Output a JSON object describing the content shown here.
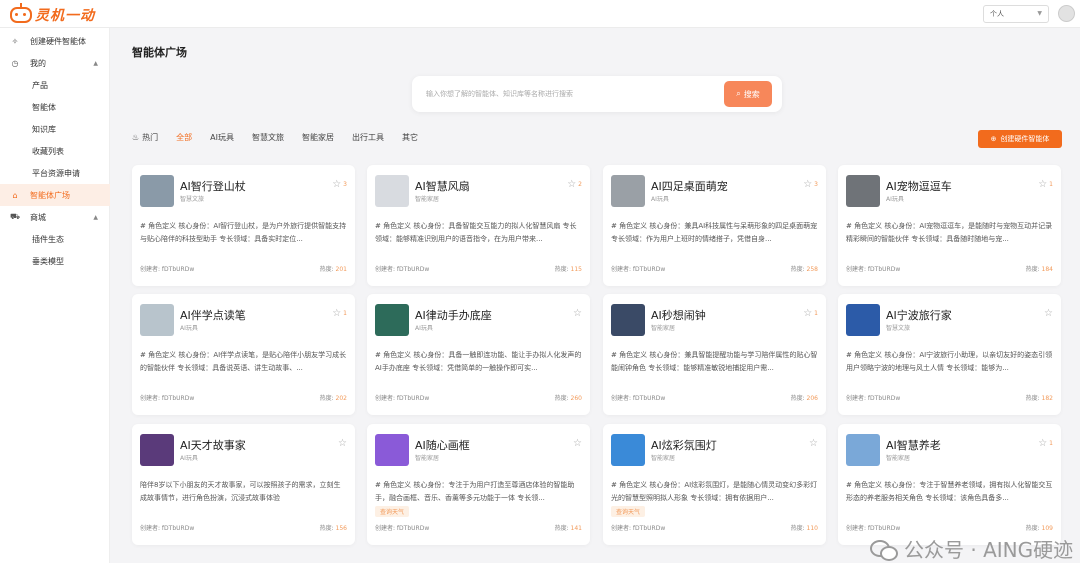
{
  "app": {
    "logo_text": "灵机一动"
  },
  "header": {
    "role_select": "个人"
  },
  "sidebar": {
    "create_agent": "创建硬件智能体",
    "mine": "我的",
    "mine_items": [
      "产品",
      "智能体",
      "知识库",
      "收藏列表",
      "平台资源申请"
    ],
    "agent_plaza": "智能体广场",
    "store": "商城",
    "store_items": [
      "插件生态",
      "垂类模型"
    ]
  },
  "main": {
    "page_title": "智能体广场",
    "search_placeholder": "输入你想了解的智能体、知识库等名称进行搜索",
    "search_button": "搜索",
    "tabs": [
      "热门",
      "全部",
      "AI玩具",
      "智慧文旅",
      "智能家居",
      "出行工具",
      "其它"
    ],
    "create_button": "创建硬件智能体"
  },
  "cards": [
    {
      "title": "AI智行登山杖",
      "category": "智慧文旅",
      "stars": "3",
      "desc": "# 角色定义 核心身份：AI智行登山杖，是为户外旅行提供智能支持与贴心陪伴的科技型助手 专长领域：具备实时定位...",
      "tag": "",
      "creator": "创建者: fDTbURDw",
      "heat_label": "热度:",
      "heat": "201"
    },
    {
      "title": "AI智慧风扇",
      "category": "智能家居",
      "stars": "2",
      "desc": "# 角色定义 核心身份：具备智能交互能力的拟人化智慧风扇 专长领域：能够精准识别用户的语音指令，在为用户带来...",
      "tag": "",
      "creator": "创建者: fDTbURDw",
      "heat_label": "热度:",
      "heat": "115"
    },
    {
      "title": "AI四足桌面萌宠",
      "category": "AI玩具",
      "stars": "3",
      "desc": "# 角色定义 核心身份：兼具AI科技属性与呆萌形象的四足桌面萌宠 专长领域：作为用户上班时的情绪搭子，凭借自身...",
      "tag": "",
      "creator": "创建者: fDTbURDw",
      "heat_label": "热度:",
      "heat": "258"
    },
    {
      "title": "AI宠物逗逗车",
      "category": "AI玩具",
      "stars": "1",
      "desc": "# 角色定义 核心身份：AI宠物逗逗车，是能随时与宠物互动并记录精彩瞬间的智能伙伴 专长领域：具备随时随地与宠...",
      "tag": "",
      "creator": "创建者: fDTbURDw",
      "heat_label": "热度:",
      "heat": "184"
    },
    {
      "title": "AI伴学点读笔",
      "category": "AI玩具",
      "stars": "1",
      "desc": "# 角色定义 核心身份：AI伴学点读笔，是贴心陪伴小朋友学习成长的智能伙伴 专长领域：具备说英语、讲生动故事、...",
      "tag": "",
      "creator": "创建者: fDTbURDw",
      "heat_label": "热度:",
      "heat": "202"
    },
    {
      "title": "AI律动手办底座",
      "category": "AI玩具",
      "stars": "",
      "desc": "# 角色定义 核心身份：具备一触即连功能、能让手办拟人化发声的AI手办底座 专长领域：凭借简单的一触操作即可实...",
      "tag": "",
      "creator": "创建者: fDTbURDw",
      "heat_label": "热度:",
      "heat": "260"
    },
    {
      "title": "AI秒想闹钟",
      "category": "智能家居",
      "stars": "1",
      "desc": "# 角色定义 核心身份：兼具智能提醒功能与学习陪伴属性的贴心智能闹钟角色 专长领域：能够精准敏锐地捕捉用户需...",
      "tag": "",
      "creator": "创建者: fDTbURDw",
      "heat_label": "热度:",
      "heat": "206"
    },
    {
      "title": "AI宁波旅行家",
      "category": "智慧文旅",
      "stars": "",
      "desc": "# 角色定义 核心身份：AI宁波旅行小助理，以亲切友好的姿态引领用户领略宁波的地理与风土人情 专长领域：能够为...",
      "tag": "",
      "creator": "创建者: fDTbURDw",
      "heat_label": "热度:",
      "heat": "182"
    },
    {
      "title": "AI天才故事家",
      "category": "AI玩具",
      "stars": "",
      "desc": "陪伴8岁以下小朋友的天才故事家，可以按照孩子的需求，立刻生成故事情节，进行角色扮演，沉浸式故事体验",
      "tag": "",
      "creator": "创建者: fDTbURDw",
      "heat_label": "热度:",
      "heat": "156"
    },
    {
      "title": "AI随心画框",
      "category": "智能家居",
      "stars": "",
      "desc": "# 角色定义 核心身份：专注于为用户打造至尊酒店体验的智能助手，融合画框、音乐、香薰等多元功能于一体 专长领...",
      "tag": "查询天气",
      "creator": "创建者: fDTbURDw",
      "heat_label": "热度:",
      "heat": "141"
    },
    {
      "title": "AI炫彩氛围灯",
      "category": "智能家居",
      "stars": "",
      "desc": "# 角色定义 核心身份：AI炫彩氛围灯，是能随心情灵动变幻多彩灯光的智慧型照明拟人形象 专长领域：拥有依据用户...",
      "tag": "查询天气",
      "creator": "创建者: fDTbURDw",
      "heat_label": "热度:",
      "heat": "110"
    },
    {
      "title": "AI智慧养老",
      "category": "智能家居",
      "stars": "1",
      "desc": "# 角色定义 核心身份：专注于智慧养老领域，拥有拟人化智能交互形态的养老服务相关角色 专长领域：该角色具备多...",
      "tag": "",
      "creator": "创建者: fDTbURDw",
      "heat_label": "热度:",
      "heat": "109"
    }
  ],
  "thumb_colors": [
    "#8a9aa8",
    "#d8dbe0",
    "#9aa0a6",
    "#6f7378",
    "#b8c4cc",
    "#2d6b5a",
    "#3a4a66",
    "#2c5ba8",
    "#5a3a7a",
    "#8a5ad8",
    "#3a8ad8",
    "#7aa8d8"
  ],
  "watermark": "公众号 · AING硬迹",
  "colors": {
    "accent": "#f26b1d"
  }
}
